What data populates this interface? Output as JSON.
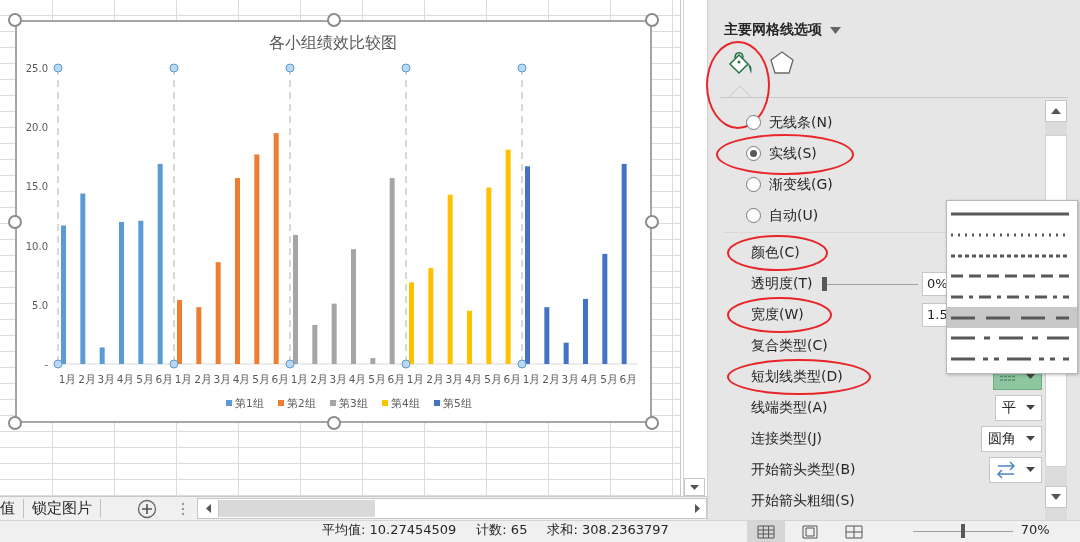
{
  "sheet": {
    "chart": {
      "chart_data": {
        "type": "bar",
        "title": "各小组绩效比较图",
        "categories": [
          "1月",
          "2月",
          "3月",
          "4月",
          "5月",
          "6月",
          "1月",
          "2月",
          "3月",
          "4月",
          "5月",
          "6月",
          "1月",
          "2月",
          "3月",
          "4月",
          "5月",
          "6月",
          "1月",
          "2月",
          "3月",
          "4月",
          "5月",
          "6月",
          "1月",
          "2月",
          "3月",
          "4月",
          "5月",
          "6月"
        ],
        "series": [
          {
            "name": "第1组",
            "color": "#5b9bd5",
            "values": [
              11.7,
              14.4,
              1.4,
              12.0,
              12.1,
              16.9,
              null,
              null,
              null,
              null,
              null,
              null,
              null,
              null,
              null,
              null,
              null,
              null,
              null,
              null,
              null,
              null,
              null,
              null,
              null,
              null,
              null,
              null,
              null,
              null
            ]
          },
          {
            "name": "第2组",
            "color": "#ed7d31",
            "values": [
              null,
              null,
              null,
              null,
              null,
              null,
              5.4,
              4.8,
              8.6,
              15.7,
              17.7,
              19.5,
              null,
              null,
              null,
              null,
              null,
              null,
              null,
              null,
              null,
              null,
              null,
              null,
              null,
              null,
              null,
              null,
              null,
              null
            ]
          },
          {
            "name": "第3组",
            "color": "#a5a5a5",
            "values": [
              null,
              null,
              null,
              null,
              null,
              null,
              null,
              null,
              null,
              null,
              null,
              null,
              10.9,
              3.3,
              5.1,
              9.7,
              0.5,
              15.7,
              null,
              null,
              null,
              null,
              null,
              null,
              null,
              null,
              null,
              null,
              null,
              null
            ]
          },
          {
            "name": "第4组",
            "color": "#ffc000",
            "values": [
              null,
              null,
              null,
              null,
              null,
              null,
              null,
              null,
              null,
              null,
              null,
              null,
              null,
              null,
              null,
              null,
              null,
              null,
              6.9,
              8.1,
              14.3,
              4.5,
              14.9,
              18.1,
              null,
              null,
              null,
              null,
              null,
              null
            ]
          },
          {
            "name": "第5组",
            "color": "#4472c4",
            "values": [
              null,
              null,
              null,
              null,
              null,
              null,
              null,
              null,
              null,
              null,
              null,
              null,
              null,
              null,
              null,
              null,
              null,
              null,
              null,
              null,
              null,
              null,
              null,
              null,
              16.7,
              4.8,
              1.8,
              5.5,
              9.3,
              16.9
            ]
          }
        ],
        "legend": "bottom",
        "ylim": [
          0,
          25
        ],
        "yticks": [
          {
            "value": 0,
            "label": "-"
          },
          {
            "value": 5,
            "label": "5.0"
          },
          {
            "value": 10,
            "label": "10.0"
          },
          {
            "value": 15,
            "label": "15.0"
          },
          {
            "value": 20,
            "label": "20.0"
          },
          {
            "value": 25,
            "label": "25.0"
          }
        ]
      }
    },
    "sheet_tabs": [
      {
        "label": "值"
      },
      {
        "label": "锁定图片"
      }
    ]
  },
  "format_pane": {
    "title": "主要网格线选项",
    "tabs": [
      {
        "kind": "fill",
        "selected": true,
        "circled": true
      },
      {
        "kind": "effects",
        "selected": false,
        "circled": false
      }
    ],
    "line_options": [
      {
        "label": "无线条(N)",
        "selected": false,
        "circled": false
      },
      {
        "label": "实线(S)",
        "selected": true,
        "circled": true
      },
      {
        "label": "渐变线(G)",
        "selected": false,
        "circled": false
      },
      {
        "label": "自动(U)",
        "selected": false,
        "circled": false
      }
    ],
    "properties": [
      {
        "label": "颜色(C)",
        "kind": "plain",
        "circled": true
      },
      {
        "label": "透明度(T)",
        "kind": "slider",
        "level": 0,
        "value": "0%",
        "circled": false
      },
      {
        "label": "宽度(W)",
        "kind": "number",
        "value": "1.5",
        "circled": true
      },
      {
        "label": "复合类型(C)",
        "kind": "plain",
        "circled": false
      },
      {
        "label": "短划线类型(D)",
        "kind": "dash",
        "expanded": true,
        "circled": true
      },
      {
        "label": "线端类型(A)",
        "kind": "select",
        "value": "平",
        "circled": false
      },
      {
        "label": "连接类型(J)",
        "kind": "select",
        "value": "圆角",
        "circled": false
      },
      {
        "label": "开始箭头类型(B)",
        "kind": "arrow",
        "circled": false
      },
      {
        "label": "开始箭头粗细(S)",
        "kind": "plain",
        "circled": false
      }
    ],
    "dash_styles": [
      {
        "kind": "solid",
        "selected": false
      },
      {
        "kind": "round-dot",
        "selected": false
      },
      {
        "kind": "square-dot",
        "selected": false
      },
      {
        "kind": "dash",
        "selected": false
      },
      {
        "kind": "dash-dot",
        "selected": false
      },
      {
        "kind": "long-dash",
        "selected": true
      },
      {
        "kind": "long-dash-dot",
        "selected": false
      },
      {
        "kind": "long-dash-dot-dot",
        "selected": false
      }
    ]
  },
  "status_bar": {
    "items": [
      "平均值: 10.27454509",
      "计数: 65",
      "求和: 308.2363797"
    ],
    "views": [
      {
        "kind": "normal",
        "selected": true
      },
      {
        "kind": "page-layout",
        "selected": false
      },
      {
        "kind": "page-break",
        "selected": false
      }
    ],
    "zoom_slider": {
      "level": 0.5
    },
    "zoom": "70%"
  }
}
